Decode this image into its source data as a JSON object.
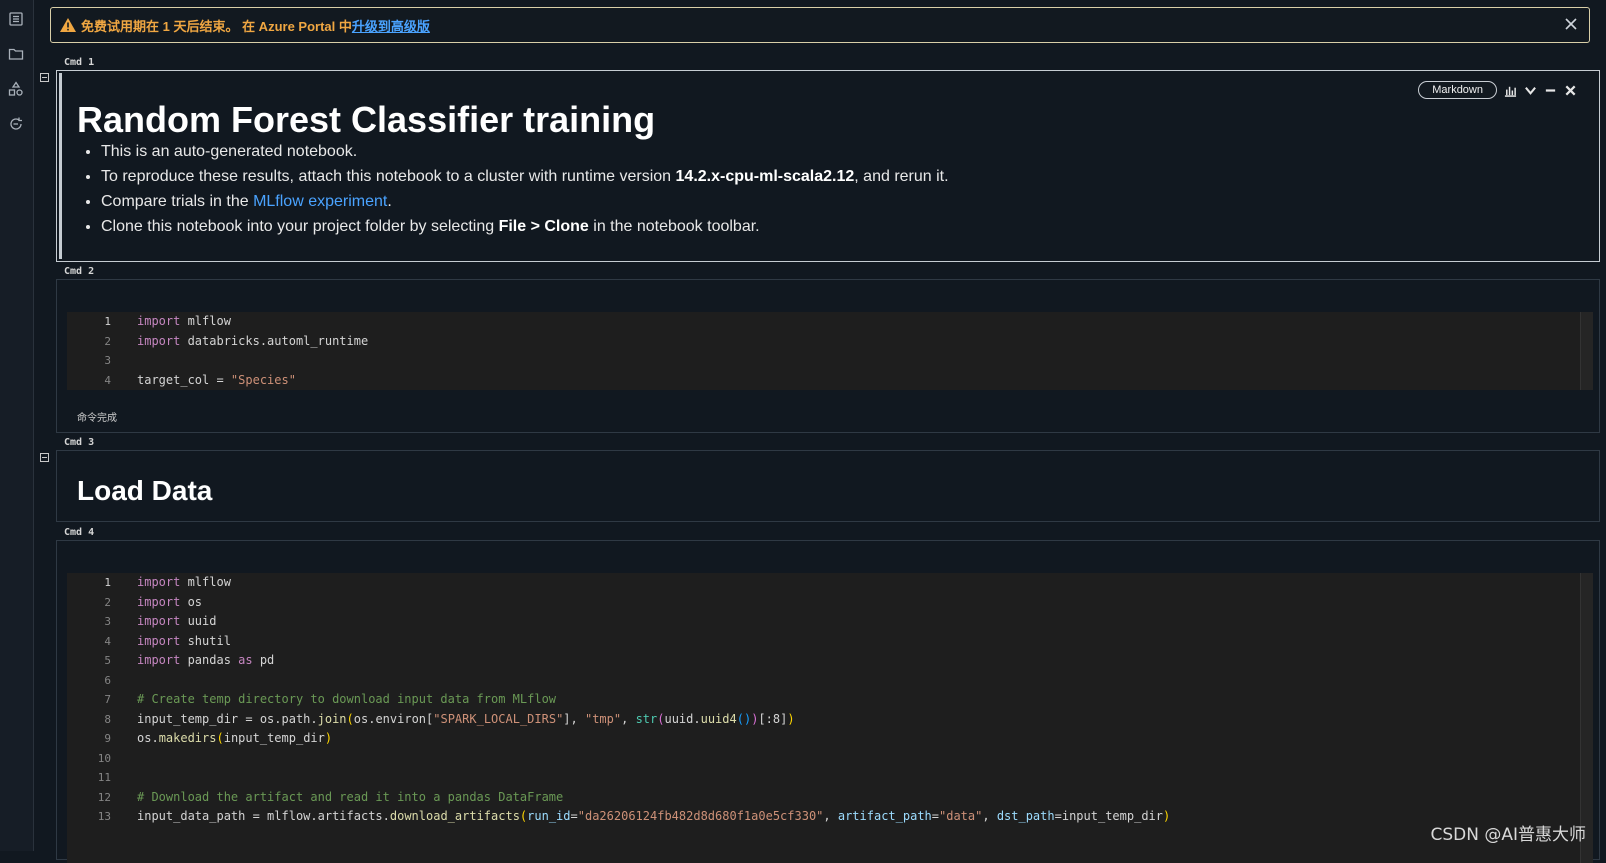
{
  "sidebar": {
    "icons": [
      "list-icon",
      "folder-icon",
      "shapes-icon",
      "refresh-chat-icon"
    ]
  },
  "banner": {
    "message": "免费试用期在 1 天后结束。 在 Azure Portal 中",
    "link": "升级到高级版"
  },
  "cells": [
    {
      "label": "Cmd 1",
      "type_button": "Markdown",
      "title": "Random Forest Classifier training",
      "bullets": {
        "b1": "This is an auto-generated notebook.",
        "b2_pre": "To reproduce these results, attach this notebook to a cluster with runtime version ",
        "b2_bold": "14.2.x-cpu-ml-scala2.12",
        "b2_post": ", and rerun it.",
        "b3_pre": "Compare trials in the ",
        "b3_link": "MLflow experiment",
        "b3_post": ".",
        "b4_pre": "Clone this notebook into your project folder by selecting ",
        "b4_bold1": "File",
        "b4_mid": " > ",
        "b4_bold2": "Clone",
        "b4_post": " in the notebook toolbar."
      }
    },
    {
      "label": "Cmd 2",
      "status": "命令完成",
      "line_numbers": [
        "1",
        "2",
        "3",
        "4"
      ]
    },
    {
      "label": "Cmd 3",
      "title": "Load Data"
    },
    {
      "label": "Cmd 4",
      "line_numbers": [
        "1",
        "2",
        "3",
        "4",
        "5",
        "6",
        "7",
        "8",
        "9",
        "10",
        "11",
        "12",
        "13"
      ]
    }
  ],
  "code2": {
    "l1_kw": "import",
    "l1_rest": " mlflow",
    "l2_kw": "import",
    "l2_rest": " databricks.automl_runtime",
    "l4_a": "target_col = ",
    "l4_str": "\"Species\""
  },
  "code4": {
    "l1_kw": "import",
    "l1_rest": " mlflow",
    "l2_kw": "import",
    "l2_rest": " os",
    "l3_kw": "import",
    "l3_rest": " uuid",
    "l4_kw": "import",
    "l4_rest": " shutil",
    "l5_kw": "import",
    "l5_a": " pandas ",
    "l5_as": "as",
    "l5_b": " pd",
    "l7_comment": "# Create temp directory to download input data from MLflow",
    "l8_a": "input_temp_dir = os.path.",
    "l8_join": "join",
    "l8_b": "os.environ[",
    "l8_s1": "\"SPARK_LOCAL_DIRS\"",
    "l8_c": "], ",
    "l8_s2": "\"tmp\"",
    "l8_d": ", ",
    "l8_str": "str",
    "l8_e": "uuid.",
    "l8_uuid4": "uuid4",
    "l8_f": "[:8]",
    "l9_a": "os.",
    "l9_fn": "makedirs",
    "l9_b": "input_temp_dir",
    "l12_comment": "# Download the artifact and read it into a pandas DataFrame",
    "l13_a": "input_data_path = mlflow.artifacts.",
    "l13_fn": "download_artifacts",
    "l13_p1": "run_id",
    "l13_s1": "\"da26206124fb482d8d680f1a0e5cf330\"",
    "l13_c1": ", ",
    "l13_p2": "artifact_path",
    "l13_s2": "\"data\"",
    "l13_c2": ", ",
    "l13_p3": "dst_path",
    "l13_b": "input_temp_dir"
  },
  "watermark": "CSDN @AI普惠大师",
  "colors": {
    "background": "#111820",
    "banner_text": "#f0a742",
    "link": "#4aa3ff",
    "code_bg": "#1e1e1e",
    "keyword": "#c586c0",
    "string": "#ce9178",
    "comment": "#6a9955"
  }
}
